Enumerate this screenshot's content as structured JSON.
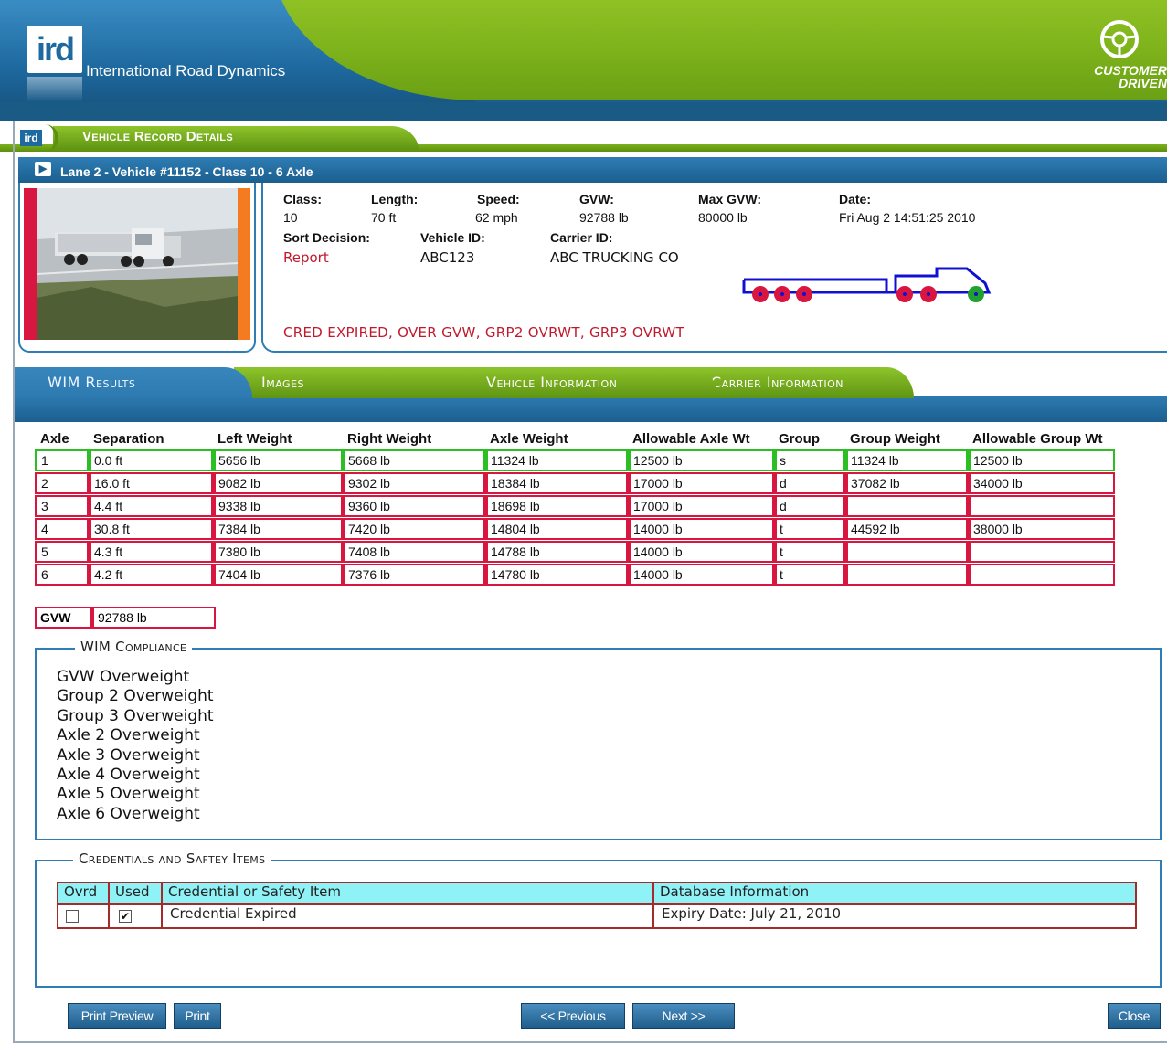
{
  "header": {
    "company_name": "International Road Dynamics",
    "logo_text": "ird",
    "tagline_line1": "CUSTOMER",
    "tagline_line2": "DRIVEN"
  },
  "page": {
    "title": "Vehicle Record Details",
    "title_icon_text": "ird"
  },
  "record": {
    "title": "Lane 2 - Vehicle #11152 - Class 10 - 6 Axle",
    "fields": {
      "class_label": "Class:",
      "class_value": "10",
      "length_label": "Length:",
      "length_value": "70 ft",
      "speed_label": "Speed:",
      "speed_value": "62 mph",
      "gvw_label": "GVW:",
      "gvw_value": "92788 lb",
      "max_gvw_label": "Max GVW:",
      "max_gvw_value": "80000 lb",
      "date_label": "Date:",
      "date_value": "Fri Aug 2 14:51:25 2010",
      "sort_label": "Sort Decision:",
      "sort_value": "Report",
      "vehicle_id_label": "Vehicle ID:",
      "vehicle_id_value": "ABC123",
      "carrier_id_label": "Carrier ID:",
      "carrier_id_value": "ABC TRUCKING CO"
    },
    "alerts": "CRED EXPIRED, OVER GVW, GRP2 OVRWT, GRP3 OVRWT",
    "colors": {
      "violation": "#d9163f",
      "ok": "#2bbf24",
      "steer": "#22a030",
      "trailer": "#1010d0"
    }
  },
  "tabs": [
    {
      "label": "WIM Results",
      "active": true
    },
    {
      "label": "Images",
      "active": false
    },
    {
      "label": "Vehicle Information",
      "active": false
    },
    {
      "label": "Carrier Information",
      "active": false
    }
  ],
  "axle_table": {
    "headers": [
      "Axle",
      "Separation",
      "Left Weight",
      "Right Weight",
      "Axle Weight",
      "Allowable Axle Wt",
      "Group",
      "Group Weight",
      "Allowable Group Wt"
    ],
    "rows": [
      {
        "status": "ok",
        "cells": [
          "1",
          "0.0 ft",
          "5656 lb",
          "5668 lb",
          "11324 lb",
          "12500 lb",
          "s",
          "11324 lb",
          "12500 lb"
        ]
      },
      {
        "status": "over",
        "cells": [
          "2",
          "16.0 ft",
          "9082 lb",
          "9302 lb",
          "18384 lb",
          "17000 lb",
          "d",
          "37082 lb",
          "34000 lb"
        ]
      },
      {
        "status": "over",
        "cells": [
          "3",
          "4.4 ft",
          "9338 lb",
          "9360 lb",
          "18698 lb",
          "17000 lb",
          "d",
          "",
          ""
        ]
      },
      {
        "status": "over",
        "cells": [
          "4",
          "30.8 ft",
          "7384 lb",
          "7420 lb",
          "14804 lb",
          "14000 lb",
          "t",
          "44592 lb",
          "38000 lb"
        ]
      },
      {
        "status": "over",
        "cells": [
          "5",
          "4.3 ft",
          "7380 lb",
          "7408 lb",
          "14788 lb",
          "14000 lb",
          "t",
          "",
          ""
        ]
      },
      {
        "status": "over",
        "cells": [
          "6",
          "4.2 ft",
          "7404 lb",
          "7376 lb",
          "14780 lb",
          "14000 lb",
          "t",
          "",
          ""
        ]
      }
    ]
  },
  "gvw": {
    "label": "GVW",
    "value": "92788 lb"
  },
  "compliance": {
    "title": "WIM Compliance",
    "items": [
      "GVW Overweight",
      "Group 2 Overweight",
      "Group 3 Overweight",
      "Axle 2 Overweight",
      "Axle 3 Overweight",
      "Axle 4 Overweight",
      "Axle 5 Overweight",
      "Axle 6 Overweight"
    ]
  },
  "credentials": {
    "title": "Credentials and Saftey Items",
    "headers": [
      "Ovrd",
      "Used",
      "Credential or Safety Item",
      "Database Information"
    ],
    "rows": [
      {
        "ovrd": false,
        "used": true,
        "item": "Credential Expired",
        "info": "Expiry Date: July 21, 2010"
      }
    ]
  },
  "buttons": {
    "print_preview": "Print Preview",
    "print": "Print",
    "previous": "<< Previous",
    "next": "Next >>",
    "close": "Close"
  }
}
